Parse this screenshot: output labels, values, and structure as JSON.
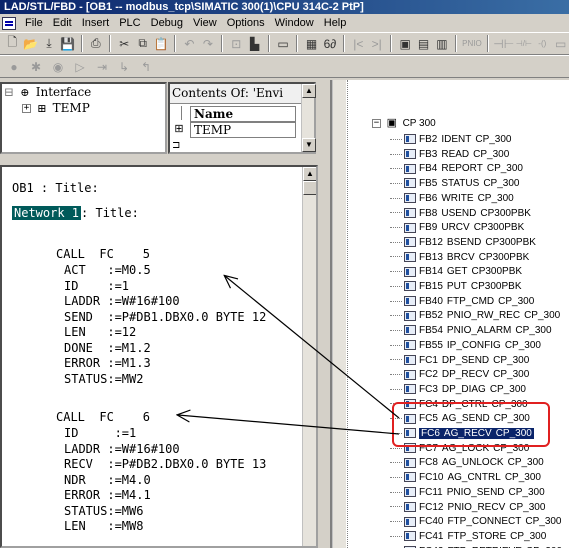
{
  "window": {
    "title": "LAD/STL/FBD  - [OB1 -- modbus_tcp\\SIMATIC 300(1)\\CPU 314C-2 PtP]"
  },
  "menu": [
    "File",
    "Edit",
    "Insert",
    "PLC",
    "Debug",
    "View",
    "Options",
    "Window",
    "Help"
  ],
  "toolbar1": [
    {
      "icon": "new-icon",
      "glyph": "🗋"
    },
    {
      "icon": "open-icon",
      "glyph": "📂"
    },
    {
      "icon": "download-icon",
      "glyph": "⤓"
    },
    {
      "icon": "save-icon",
      "glyph": "💾"
    },
    {
      "sep": true
    },
    {
      "icon": "print-icon",
      "glyph": "⎙"
    },
    {
      "sep": true
    },
    {
      "icon": "cut-icon",
      "glyph": "✂"
    },
    {
      "icon": "copy-icon",
      "glyph": "⧉"
    },
    {
      "icon": "paste-icon",
      "glyph": "📋"
    },
    {
      "sep": true
    },
    {
      "icon": "undo-icon",
      "glyph": "↶",
      "disabled": true
    },
    {
      "icon": "redo-icon",
      "glyph": "↷",
      "disabled": true
    },
    {
      "sep": true
    },
    {
      "icon": "accessible-nodes-icon",
      "glyph": "⊡",
      "disabled": true
    },
    {
      "icon": "compare-icon",
      "glyph": "▙"
    },
    {
      "sep": true
    },
    {
      "icon": "online-icon",
      "glyph": "▭"
    },
    {
      "sep": true
    },
    {
      "icon": "module-info-icon",
      "glyph": "▦"
    },
    {
      "icon": "monitor-icon",
      "glyph": "6∂"
    },
    {
      "sep": true
    },
    {
      "icon": "prev-network-icon",
      "glyph": "|<",
      "disabled": true
    },
    {
      "icon": "next-network-icon",
      "glyph": ">|",
      "disabled": true
    },
    {
      "sep": true
    },
    {
      "icon": "overview-icon",
      "glyph": "▣"
    },
    {
      "icon": "program-elements-icon",
      "glyph": "▤"
    },
    {
      "icon": "details-icon",
      "glyph": "▥"
    },
    {
      "sep": true
    },
    {
      "icon": "pnio-icon",
      "glyph": "PNIO",
      "disabled": true
    },
    {
      "sep": true
    },
    {
      "icon": "contact-no-icon",
      "glyph": "⊣⊢",
      "disabled": true
    },
    {
      "icon": "contact-nc-icon",
      "glyph": "⊣/⊢",
      "disabled": true
    },
    {
      "icon": "coil-icon",
      "glyph": "-()",
      "disabled": true
    },
    {
      "icon": "branch-icon",
      "glyph": "▭",
      "disabled": true
    }
  ],
  "toolbar2": [
    {
      "icon": "breakpoint-icon",
      "glyph": "●",
      "disabled": true
    },
    {
      "icon": "clear-breakpoint-icon",
      "glyph": "✱",
      "disabled": true
    },
    {
      "icon": "breakpoint-active-icon",
      "glyph": "◉",
      "disabled": true
    },
    {
      "icon": "resume-icon",
      "glyph": "▷",
      "disabled": true
    },
    {
      "icon": "step-over-icon",
      "glyph": "⇥",
      "disabled": true
    },
    {
      "icon": "step-into-icon",
      "glyph": "↳",
      "disabled": true
    },
    {
      "icon": "step-out-icon",
      "glyph": "↰",
      "disabled": true
    }
  ],
  "interface_tree": {
    "root": "Interface",
    "child": "TEMP"
  },
  "contents": {
    "header": "Contents Of: 'Envi",
    "column": "Name",
    "row": "TEMP"
  },
  "code": {
    "block_title": "OB1 : Title:",
    "network_label": "Network 1",
    "network_title": ": Title:",
    "call1": {
      "call": "CALL  FC    5",
      "params": [
        "ACT   :=M0.5",
        "ID    :=1",
        "LADDR :=W#16#100",
        "SEND  :=P#DB1.DBX0.0 BYTE 12",
        "LEN   :=12",
        "DONE  :=M1.2",
        "ERROR :=M1.3",
        "STATUS:=MW2"
      ]
    },
    "call2": {
      "call": "CALL  FC    6",
      "params": [
        "ID     :=1",
        "LADDR :=W#16#100",
        "RECV  :=P#DB2.DBX0.0 BYTE 13",
        "NDR   :=M4.0",
        "ERROR :=M4.1",
        "STATUS:=MW6",
        "LEN   :=MW8"
      ]
    }
  },
  "library_tree": {
    "root": "CP 300",
    "items": [
      {
        "id": "FB2",
        "name": "IDENT",
        "lib": "CP_300"
      },
      {
        "id": "FB3",
        "name": "READ",
        "lib": "CP_300"
      },
      {
        "id": "FB4",
        "name": "REPORT",
        "lib": "CP_300"
      },
      {
        "id": "FB5",
        "name": "STATUS",
        "lib": "CP_300"
      },
      {
        "id": "FB6",
        "name": "WRITE",
        "lib": "CP_300"
      },
      {
        "id": "FB8",
        "name": "USEND",
        "lib": "CP300PBK"
      },
      {
        "id": "FB9",
        "name": "URCV",
        "lib": "CP300PBK"
      },
      {
        "id": "FB12",
        "name": "BSEND",
        "lib": "CP300PBK"
      },
      {
        "id": "FB13",
        "name": "BRCV",
        "lib": "CP300PBK"
      },
      {
        "id": "FB14",
        "name": "GET",
        "lib": "CP300PBK"
      },
      {
        "id": "FB15",
        "name": "PUT",
        "lib": "CP300PBK"
      },
      {
        "id": "FB40",
        "name": "FTP_CMD",
        "lib": "CP_300"
      },
      {
        "id": "FB52",
        "name": "PNIO_RW_REC",
        "lib": "CP_300"
      },
      {
        "id": "FB54",
        "name": "PNIO_ALARM",
        "lib": "CP_300"
      },
      {
        "id": "FB55",
        "name": "IP_CONFIG",
        "lib": "CP_300"
      },
      {
        "id": "FC1",
        "name": "DP_SEND",
        "lib": "CP_300"
      },
      {
        "id": "FC2",
        "name": "DP_RECV",
        "lib": "CP_300"
      },
      {
        "id": "FC3",
        "name": "DP_DIAG",
        "lib": "CP_300"
      },
      {
        "id": "FC4",
        "name": "DP_CTRL",
        "lib": "CP_300"
      },
      {
        "id": "FC5",
        "name": "AG_SEND",
        "lib": "CP_300"
      },
      {
        "id": "FC6",
        "name": "AG_RECV",
        "lib": "CP_300",
        "selected": true
      },
      {
        "id": "FC7",
        "name": "AG_LOCK",
        "lib": "CP_300"
      },
      {
        "id": "FC8",
        "name": "AG_UNLOCK",
        "lib": "CP_300"
      },
      {
        "id": "FC10",
        "name": "AG_CNTRL",
        "lib": "CP_300"
      },
      {
        "id": "FC11",
        "name": "PNIO_SEND",
        "lib": "CP_300"
      },
      {
        "id": "FC12",
        "name": "PNIO_RECV",
        "lib": "CP_300"
      },
      {
        "id": "FC40",
        "name": "FTP_CONNECT",
        "lib": "CP_300"
      },
      {
        "id": "FC41",
        "name": "FTP_STORE",
        "lib": "CP_300"
      },
      {
        "id": "FC42",
        "name": "FTP_RETRIEVE",
        "lib": "CP_300"
      }
    ]
  }
}
